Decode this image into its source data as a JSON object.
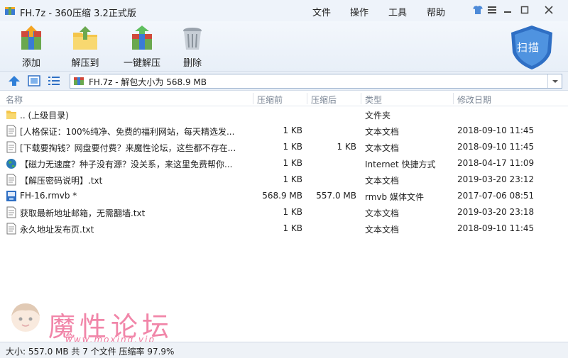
{
  "window": {
    "title": "FH.7z - 360压缩 3.2正式版",
    "menu": [
      "文件",
      "操作",
      "工具",
      "帮助"
    ]
  },
  "toolbar": {
    "add_label": "添加",
    "extract_to_label": "解压到",
    "one_click_label": "一键解压",
    "delete_label": "删除",
    "scan_label": "扫描"
  },
  "address": {
    "path": "FH.7z - 解包大小为 568.9 MB"
  },
  "columns": {
    "name": "名称",
    "size": "压缩前",
    "packed": "压缩后",
    "type": "类型",
    "date": "修改日期"
  },
  "files": [
    {
      "icon": "folder-icon",
      "name": ".. (上级目录)",
      "size": "",
      "packed": "",
      "type": "文件夹",
      "date": ""
    },
    {
      "icon": "text-file-icon",
      "name": "[人格保证：100%纯净、免费的福利网站，每天精选发...",
      "size": "1 KB",
      "packed": "",
      "type": "文本文档",
      "date": "2018-09-10 11:45"
    },
    {
      "icon": "text-file-icon",
      "name": "[下载要掏钱？网盘要付费？来魔性论坛，这些都不存在...",
      "size": "1 KB",
      "packed": "1 KB",
      "type": "文本文档",
      "date": "2018-09-10 11:45"
    },
    {
      "icon": "internet-shortcut-icon",
      "name": "【磁力无速度？种子没有源？没关系，来这里免费帮你...",
      "size": "1 KB",
      "packed": "",
      "type": "Internet 快捷方式",
      "date": "2018-04-17 11:09"
    },
    {
      "icon": "text-file-icon",
      "name": "【解压密码说明】.txt",
      "size": "1 KB",
      "packed": "",
      "type": "文本文档",
      "date": "2019-03-20 23:12"
    },
    {
      "icon": "video-file-icon",
      "name": "FH-16.rmvb *",
      "size": "568.9 MB",
      "packed": "557.0 MB",
      "type": "rmvb 媒体文件",
      "date": "2017-07-06 08:51"
    },
    {
      "icon": "text-file-icon",
      "name": "获取最新地址邮箱，无需翻墙.txt",
      "size": "1 KB",
      "packed": "",
      "type": "文本文档",
      "date": "2019-03-20 23:18"
    },
    {
      "icon": "text-file-icon",
      "name": "永久地址发布页.txt",
      "size": "1 KB",
      "packed": "",
      "type": "文本文档",
      "date": "2018-09-10 11:45"
    }
  ],
  "watermark": {
    "text": "魔性论坛",
    "url": "www.moxing.vip"
  },
  "status": {
    "text": "大小: 557.0 MB 共 7 个文件 压缩率 97.9%"
  },
  "colors": {
    "accent": "#2f6fc4",
    "watermark": "#f07aa0",
    "folder": "#f4c54a"
  }
}
